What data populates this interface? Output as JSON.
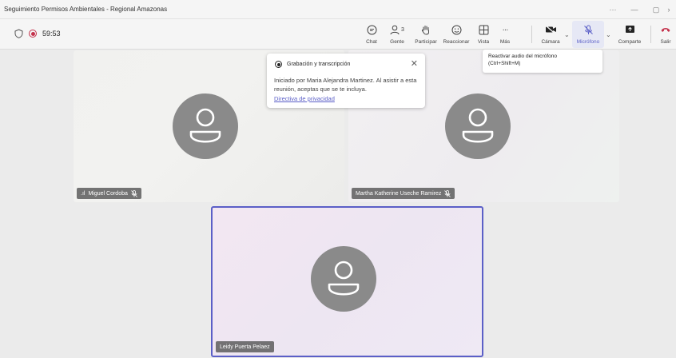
{
  "window": {
    "title": "Seguimiento Permisos Ambientales - Regional Amazonas",
    "controls": [
      "···",
      "—",
      "▢",
      "›"
    ]
  },
  "toolbar": {
    "timer": "59:53",
    "buttons": {
      "chat": "Chat",
      "people": "Gente",
      "people_count": "3",
      "raise": "Participar",
      "react": "Reaccionar",
      "view": "Vista",
      "more": "Más",
      "camera": "Cámara",
      "mic": "Micrófono",
      "share": "Comparte",
      "leave": "Salir"
    },
    "more_glyph": "···"
  },
  "tooltip": {
    "line1": "Reactivar audio del micrófono",
    "line2": "(Ctrl+Shift+M)"
  },
  "recording_popup": {
    "title": "Grabación y transcripción",
    "body": "Iniciado por Maria Alejandra Martinez. Al asistir a esta reunión, aceptas que se te incluya.",
    "link": "Directiva de privacidad",
    "close": "✕"
  },
  "participants": [
    {
      "name": "Miguel Cordoba",
      "signal": ".ıl"
    },
    {
      "name": "Martha Katherine Useche Ramirez"
    },
    {
      "name": "Leidy Puerta Pelaez"
    }
  ],
  "colors": {
    "accent": "#5b5fc7",
    "leave": "#c4314b",
    "avatar": "#8a8a8a"
  }
}
